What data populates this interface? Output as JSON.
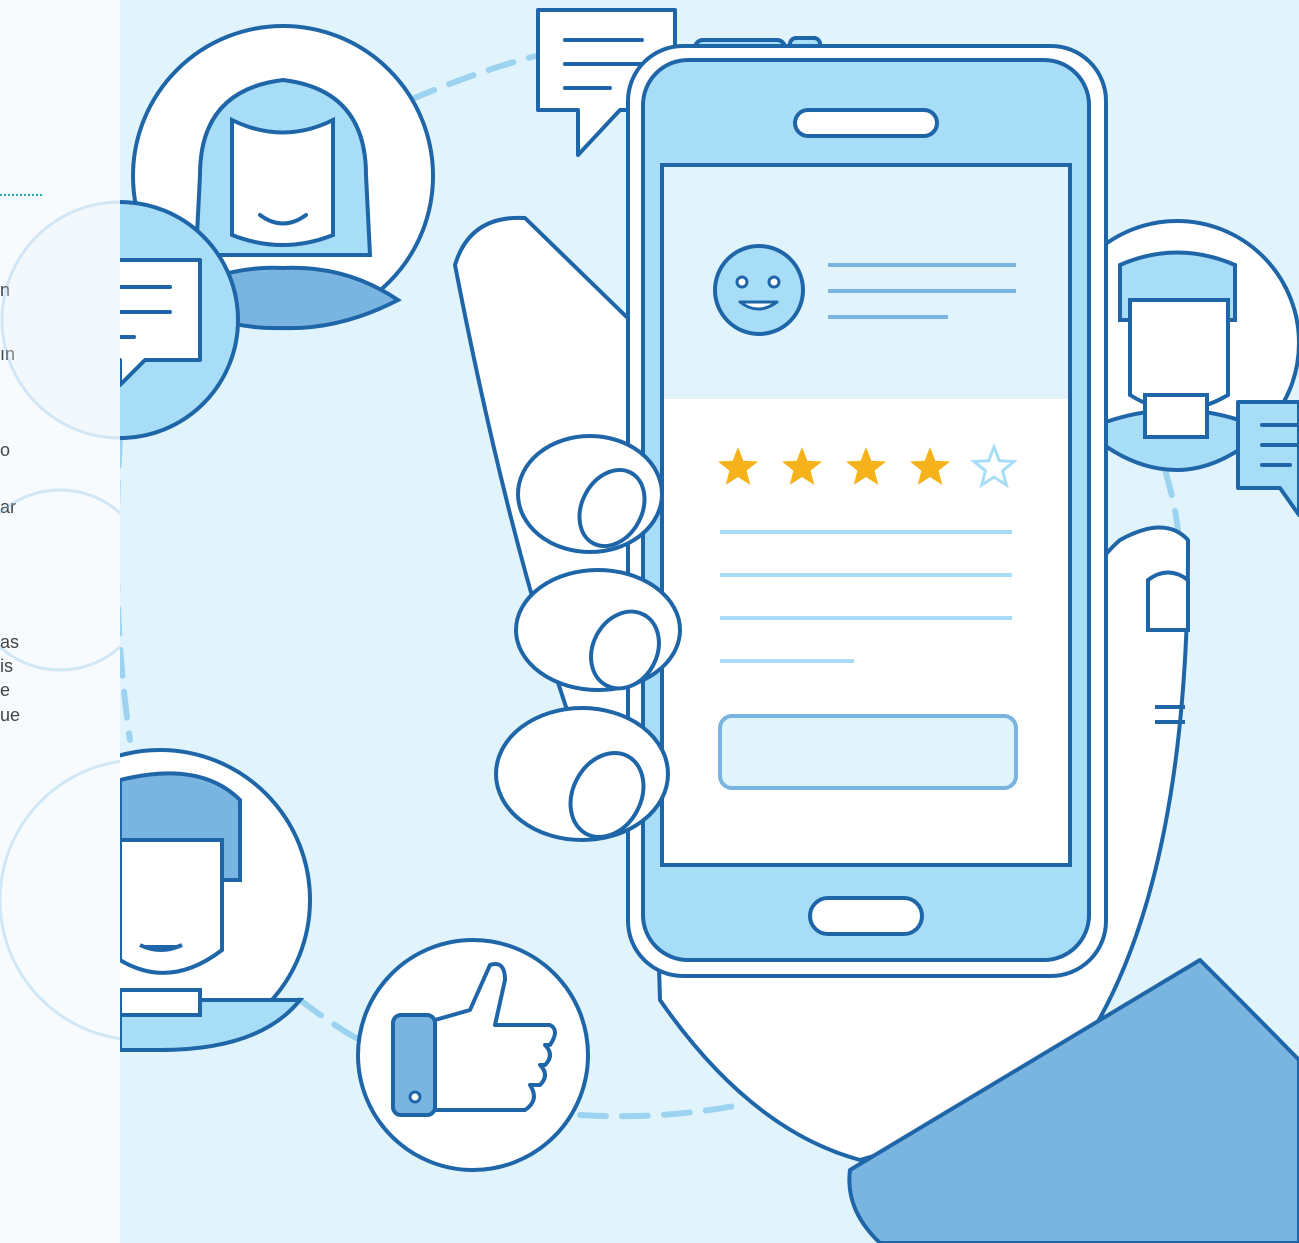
{
  "left_panel": {
    "text_fragments": [
      "n",
      "ın",
      "o",
      "ar",
      "as",
      "is",
      "e",
      "ue"
    ]
  },
  "review_card": {
    "stars_filled": 4,
    "stars_total": 5
  },
  "icons": [
    "chat-bubble-icon",
    "smiley-face-icon",
    "star-icon",
    "thumbs-up-icon",
    "user-avatar-icon",
    "smartphone-icon",
    "hand-icon"
  ],
  "colors": {
    "background": "#e1f4fc",
    "outline": "#1f66a9",
    "light_blue": "#a8ddf7",
    "mid_blue": "#7ab4e1",
    "star": "#f6b21b",
    "white": "#ffffff"
  }
}
